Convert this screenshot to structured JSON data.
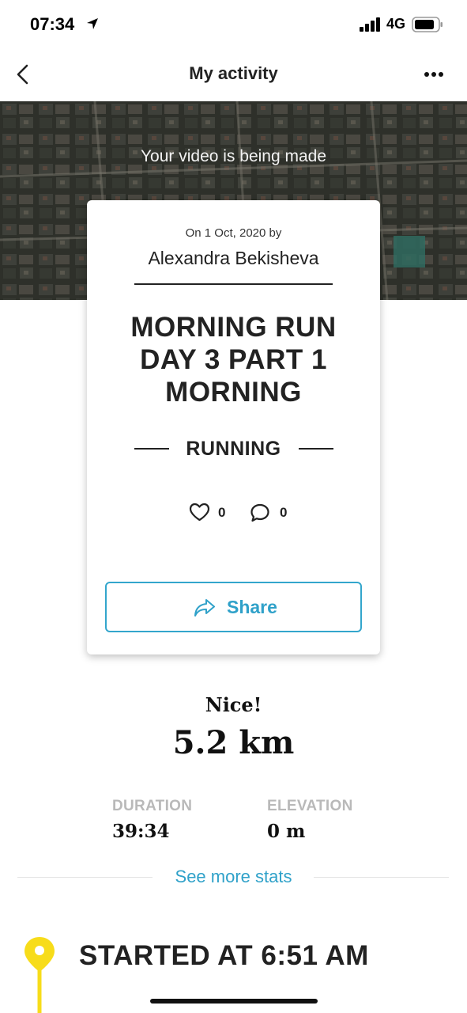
{
  "status": {
    "time": "07:34",
    "network": "4G",
    "icons": [
      "location-arrow-icon",
      "signal-bars-icon",
      "battery-icon"
    ]
  },
  "nav": {
    "title": "My activity",
    "back_icon": "chevron-left-icon",
    "more_icon": "more-dots-icon"
  },
  "banner": {
    "caption": "Your video is being made"
  },
  "card": {
    "date": "On 1 Oct, 2020 by",
    "author": "Alexandra Bekisheva",
    "title_lines": [
      "MORNING RUN",
      "DAY 3 PART 1",
      "MORNING"
    ],
    "activity_type": "RUNNING",
    "likes": "0",
    "comments": "0",
    "share_label": "Share"
  },
  "stats": {
    "headline": "Nice!",
    "distance": "5.2 km",
    "duration_label": "DURATION",
    "duration_value": "39:34",
    "elevation_label": "ELEVATION",
    "elevation_value": "0 m",
    "more_label": "See more stats"
  },
  "timeline": {
    "started_label": "STARTED AT 6:51 AM"
  },
  "colors": {
    "accent": "#2fa1c9",
    "pin": "#f7dc1a",
    "text": "#222222",
    "muted": "#b9b9b9"
  }
}
